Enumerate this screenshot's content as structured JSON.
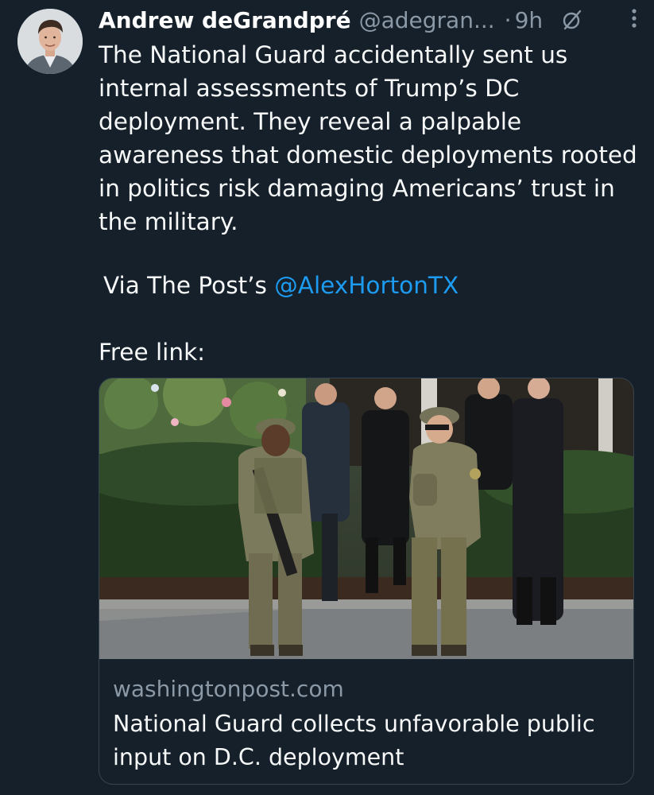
{
  "author": {
    "name": "Andrew deGrandpré",
    "handle": "@adegran...",
    "separator": "·",
    "time": "9h"
  },
  "icons": {
    "avatar": "author-avatar",
    "grok": "grok-icon",
    "more": "more-vertical-icon"
  },
  "tweet": {
    "lines": [
      "The National Guard accidentally sent us",
      "internal assessments of Trump’s DC",
      "deployment. They reveal a palpable",
      "awareness that domestic deployments rooted",
      "in politics risk damaging Americans’ trust in",
      "the military."
    ],
    "via_prefix": "Via The Post’s ",
    "via_mention": "@AlexHortonTX",
    "free_link": "Free link:"
  },
  "card": {
    "domain": "washingtonpost.com",
    "title_line1": "National Guard collects unfavorable public",
    "title_line2": "input on D.C. deployment"
  },
  "colors": {
    "background": "#15202b",
    "text": "#f7f9f9",
    "secondary": "#8b98a5",
    "link": "#1d9bf0",
    "border": "#38444d"
  }
}
